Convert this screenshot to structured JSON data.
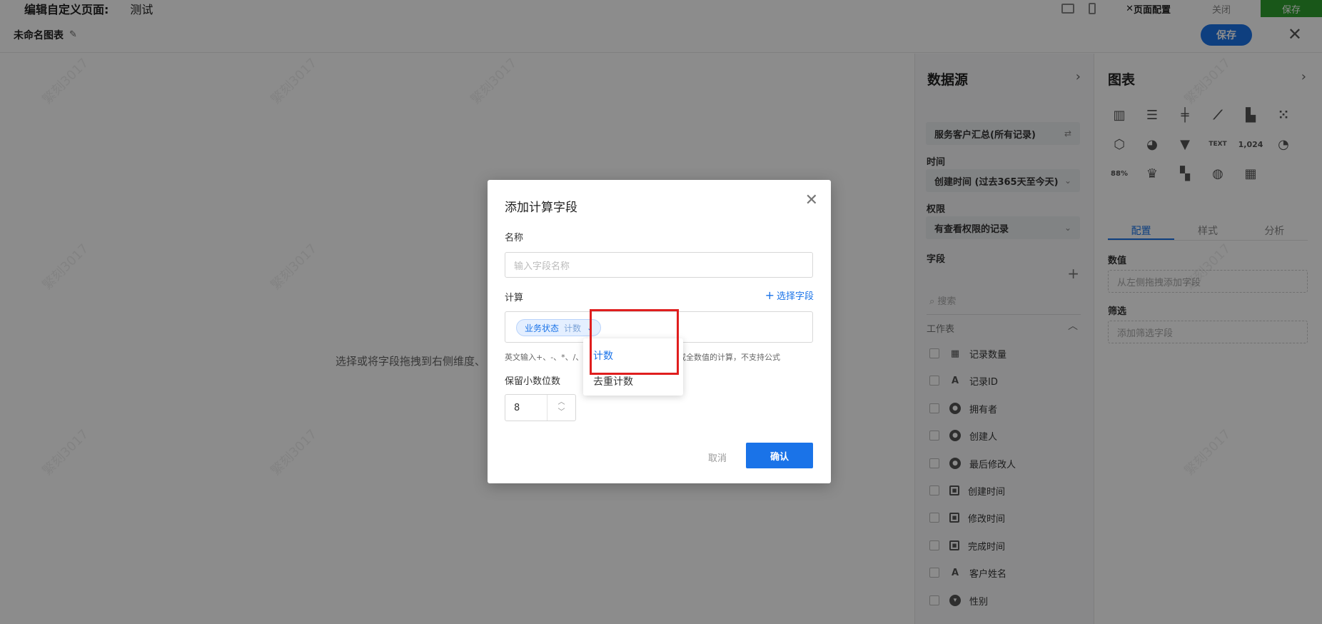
{
  "topbar": {
    "title": "编辑自定义页面:",
    "page_name": "测试",
    "config_label": "页面配置",
    "close_label": "关闭",
    "save_label": "保存"
  },
  "editor": {
    "chart_name": "未命名图表",
    "save_label": "保存",
    "canvas_hint": "选择或将字段拖拽到右侧维度、"
  },
  "datasource": {
    "title": "数据源",
    "source": "服务客户汇总(所有记录)",
    "time_label": "时间",
    "time_value": "创建时间 (过去365天至今天)",
    "permission_label": "权限",
    "permission_value": "有查看权限的记录",
    "fields_label": "字段",
    "search_placeholder": "搜索",
    "worksheet_label": "工作表",
    "fields": [
      {
        "name": "记录数量",
        "icon": "table-icon"
      },
      {
        "name": "记录ID",
        "icon": "text-icon"
      },
      {
        "name": "拥有者",
        "icon": "person-icon"
      },
      {
        "name": "创建人",
        "icon": "person-icon"
      },
      {
        "name": "最后修改人",
        "icon": "person-icon"
      },
      {
        "name": "创建时间",
        "icon": "calendar-icon"
      },
      {
        "name": "修改时间",
        "icon": "calendar-icon"
      },
      {
        "name": "完成时间",
        "icon": "calendar-icon"
      },
      {
        "name": "客户姓名",
        "icon": "text-icon"
      },
      {
        "name": "性别",
        "icon": "dropdown-icon"
      }
    ]
  },
  "chart_panel": {
    "title": "图表",
    "number_text_1": "1,024",
    "percent_text": "88%",
    "tabs": [
      "配置",
      "样式",
      "分析"
    ],
    "value_label": "数值",
    "value_placeholder": "从左侧拖拽添加字段",
    "filter_label": "筛选",
    "filter_placeholder": "添加筛选字段"
  },
  "watermark": "繁刻3017",
  "modal": {
    "title": "添加计算字段",
    "name_label": "名称",
    "name_placeholder": "输入字段名称",
    "calc_label": "计算",
    "pick_field": "选择字段",
    "tag_field": "业务状态",
    "tag_agg": "计数",
    "hint_head": "英文输入+、-、*、/、",
    "hint_tail": "值或全数值的计算，不支持公式",
    "decimal_label": "保留小数位数",
    "decimal_value": "8",
    "cancel_label": "取消",
    "confirm_label": "确认"
  },
  "dropdown": {
    "items": [
      "计数",
      "去重计数"
    ],
    "selected": "计数"
  },
  "colors": {
    "accent": "#1a73e8",
    "highlight": "#e01e1e",
    "topbar_save": "#2e9e2e"
  }
}
